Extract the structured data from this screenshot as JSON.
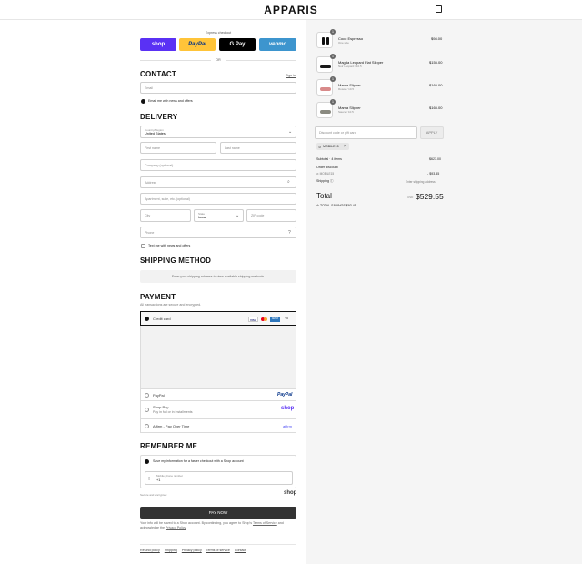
{
  "brand": "APPARIS",
  "express": {
    "label": "Express checkout",
    "shop": "shop",
    "paypal": "PayPal",
    "gpay": "G Pay",
    "venmo": "venmo",
    "or": "OR"
  },
  "contact": {
    "title": "CONTACT",
    "signin": "Sign in",
    "email_placeholder": "Email",
    "news_label": "Email me with news and offers"
  },
  "delivery": {
    "title": "DELIVERY",
    "country_label": "Country/Region",
    "country_value": "United States",
    "first_name": "First name",
    "last_name": "Last name",
    "company": "Company (optional)",
    "address": "Address",
    "apartment": "Apartment, suite, etc. (optional)",
    "city": "City",
    "state_label": "State",
    "state_value": "Iowa",
    "zip": "ZIP code",
    "phone": "Phone",
    "text_label": "Text me with news and offers"
  },
  "shipping": {
    "title": "SHIPPING METHOD",
    "note": "Enter your shipping address to view available shipping methods."
  },
  "payment": {
    "title": "PAYMENT",
    "subtitle": "All transactions are secure and encrypted.",
    "credit_card": "Credit card",
    "card_more": "+5",
    "paypal": "PayPal",
    "paypal_logo": "PayPal",
    "shop_pay": "Shop Pay",
    "shop_pay_sub": "Pay in full or in installments",
    "shop_logo": "shop",
    "affirm": "Affirm - Pay Over Time",
    "affirm_logo": "affirm"
  },
  "remember": {
    "title": "REMEMBER ME",
    "save_label": "Save my information for a faster checkout with a Shop account",
    "mobile_label": "Mobile phone number",
    "mobile_value": "+1",
    "secure": "Secure and encrypted",
    "shop_logo": "shop"
  },
  "pay_now": "PAY NOW",
  "legal": {
    "text": "Your info will be saved to a Shop account. By continuing, you agree to Shop's",
    "terms": "Terms of Service",
    "and": "and acknowledge the",
    "privacy": "Privacy Policy",
    "end": "."
  },
  "footer_links": [
    "Refund policy",
    "Shipping",
    "Privacy policy",
    "Terms of service",
    "Contact"
  ],
  "cart": {
    "items": [
      {
        "qty": "1",
        "name": "Coco Espresso",
        "variant": "One size",
        "price": "$98.00"
      },
      {
        "qty": "1",
        "name": "Magda Leopard Flat Slipper",
        "variant": "Noir Leopard / 10.5",
        "price": "$155.00"
      },
      {
        "qty": "1",
        "name": "Mama Slipper",
        "variant": "Rosée / 10.5",
        "price": "$165.00"
      },
      {
        "qty": "1",
        "name": "Mama Slipper",
        "variant": "Sauce / 10.5",
        "price": "$165.00"
      }
    ],
    "discount_placeholder": "Discount code or gift card",
    "apply": "APPLY",
    "discount_tag": "MOBILE15",
    "subtotal_label": "Subtotal · 4 items",
    "subtotal": "$623.00",
    "order_discount_label": "Order discount",
    "discount_code": "MOBILE15",
    "discount_value": "- $93.45",
    "shipping_label": "Shipping",
    "shipping_value": "Enter shipping address",
    "total_label": "Total",
    "currency": "USD",
    "total": "$529.55",
    "savings_label": "TOTAL SAVINGS",
    "savings": "$93.45"
  },
  "colors": {
    "shop": "#5a31f4",
    "paypal": "#ffc439",
    "gpay": "#000000",
    "venmo": "#3d95ce",
    "pay_button": "#333333"
  }
}
